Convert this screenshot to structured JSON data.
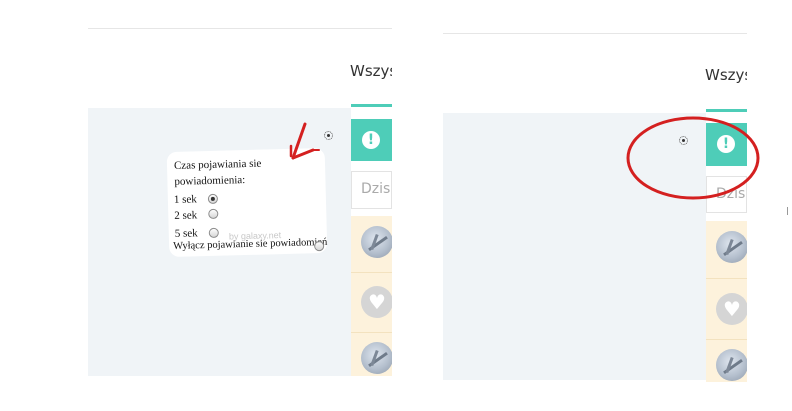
{
  "left_panel": {
    "tab_title": "Wszyst",
    "search_placeholder": "Dzisia",
    "popup": {
      "title": "Czas pojawiania sie powiadomienia:",
      "options": [
        {
          "label": "1 sek",
          "selected": true
        },
        {
          "label": "2 sek",
          "selected": false
        },
        {
          "label": "5 sek",
          "selected": false
        }
      ],
      "disable_label": "Wyłącz pojawianie sie powiadomień",
      "watermark": "by galaxy.net"
    }
  },
  "right_panel": {
    "tab_title": "Wszyst",
    "search_placeholder": "Dzisia"
  },
  "icons": {
    "alert": "exclamation-circle-icon",
    "settings": "gear-icon",
    "heart": "heart-icon",
    "annotation_arrow": "red-arrow-icon",
    "annotation_circle": "red-ellipse-icon"
  },
  "colors": {
    "accent": "#4ecdb8",
    "feed_background": "#fdf2dc",
    "annotation": "#d42020",
    "panel_background": "#f0f4f7"
  }
}
